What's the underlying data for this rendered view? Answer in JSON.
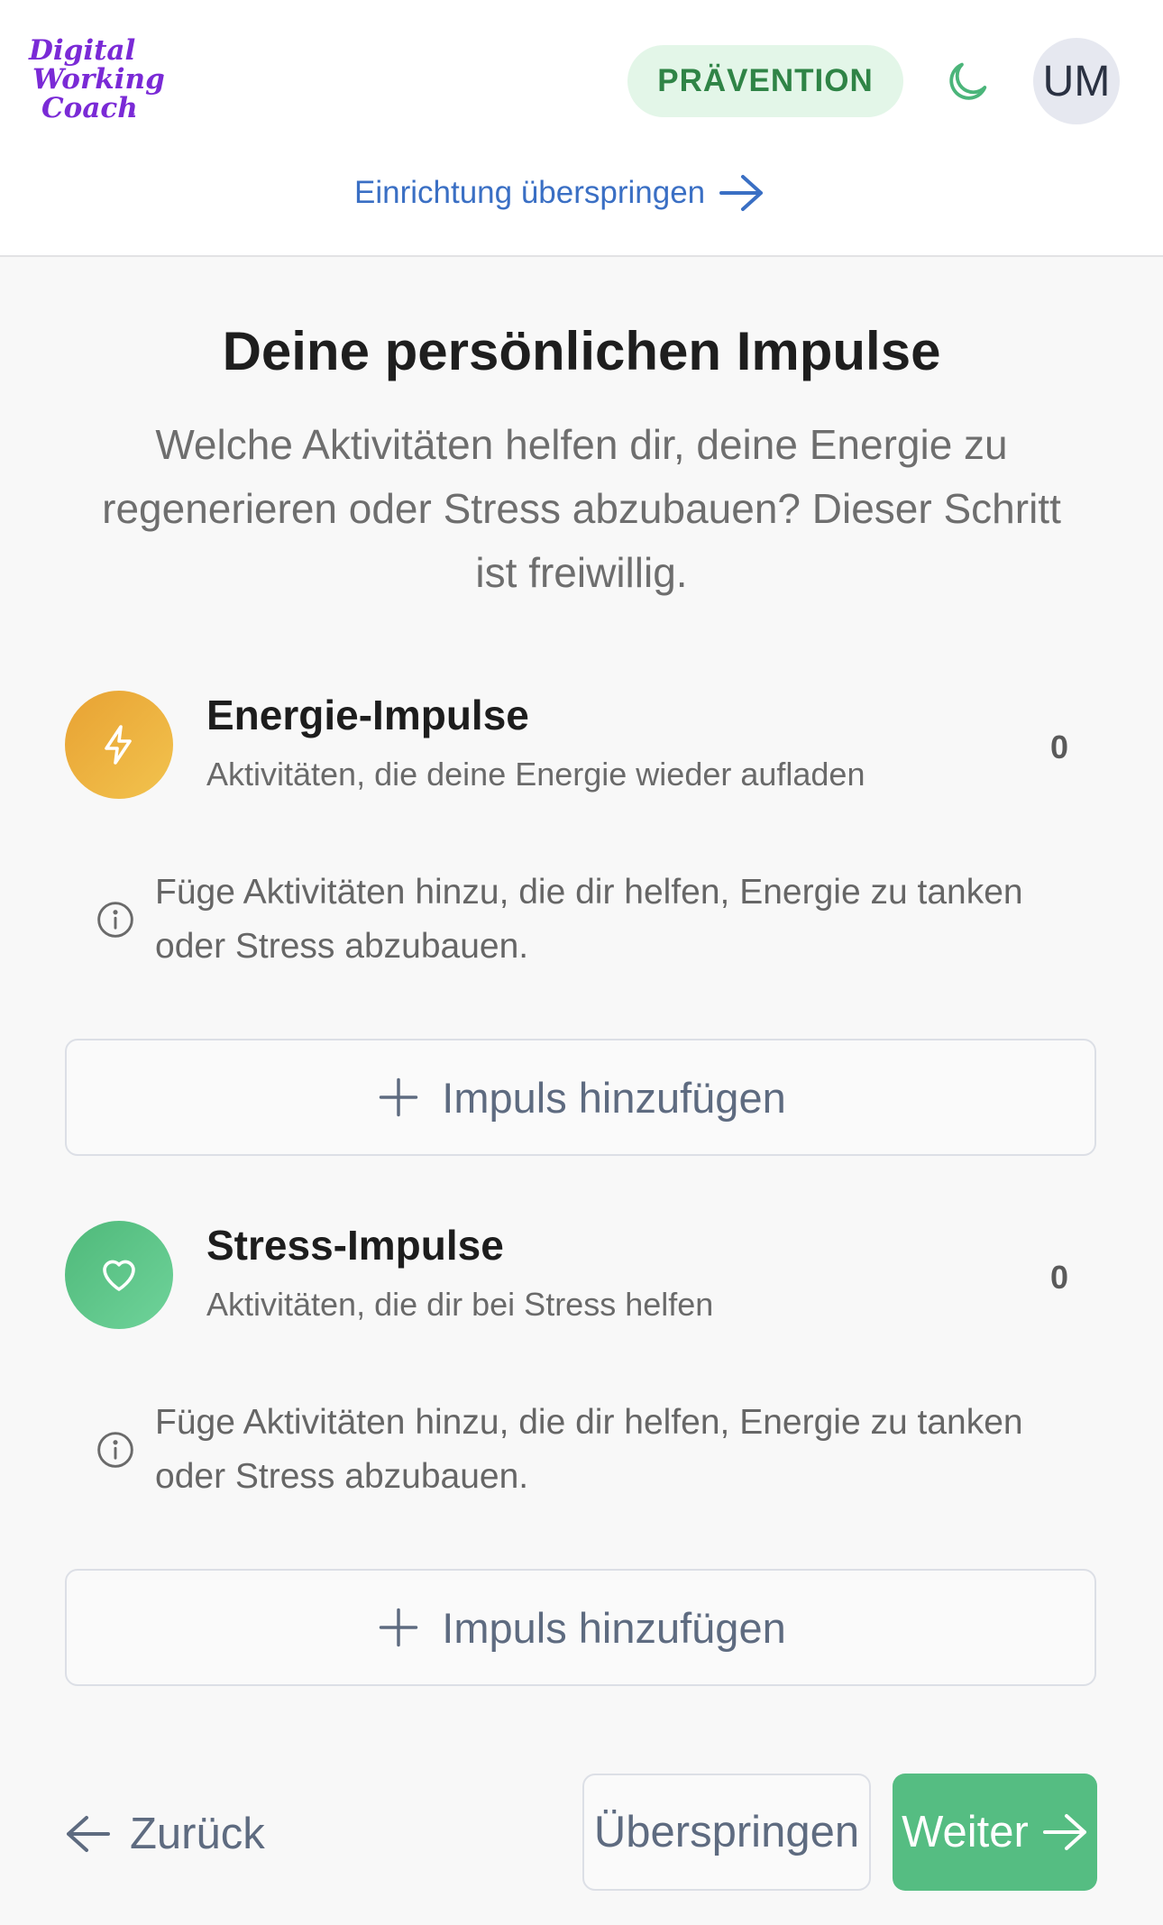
{
  "header": {
    "logo_lines": [
      "Digital",
      "Working",
      "Coach"
    ],
    "logo_tm": "™",
    "badge": "PRÄVENTION",
    "avatar_initials": "UM",
    "skip_setup": "Einrichtung überspringen"
  },
  "intro": {
    "title": "Deine persönlichen Impulse",
    "subtitle": "Welche Aktivitäten helfen dir, deine Energie zu regenerieren oder Stress abzubauen? Dieser Schritt ist freiwillig."
  },
  "sections": [
    {
      "icon": "lightning-icon",
      "title": "Energie-Impulse",
      "description": "Aktivitäten, die deine Energie wieder aufladen",
      "count": "0",
      "info": "Füge Aktivitäten hinzu, die dir helfen, Energie zu tanken oder Stress abzubauen.",
      "add_label": "Impuls hinzufügen"
    },
    {
      "icon": "heart-icon",
      "title": "Stress-Impulse",
      "description": "Aktivitäten, die dir bei Stress helfen",
      "count": "0",
      "info": "Füge Aktivitäten hinzu, die dir helfen, Energie zu tanken oder Stress abzubauen.",
      "add_label": "Impuls hinzufügen"
    }
  ],
  "footer": {
    "back_label": "Zurück",
    "skip_label": "Überspringen",
    "next_label": "Weiter"
  },
  "colors": {
    "brand_purple": "#7a2ad6",
    "badge_bg": "#e3f6e8",
    "badge_text": "#2f8446",
    "link_blue": "#3a6fc4",
    "energy_orange": "#e8a233",
    "stress_green": "#4fb97a",
    "primary_button": "#55bd82"
  }
}
